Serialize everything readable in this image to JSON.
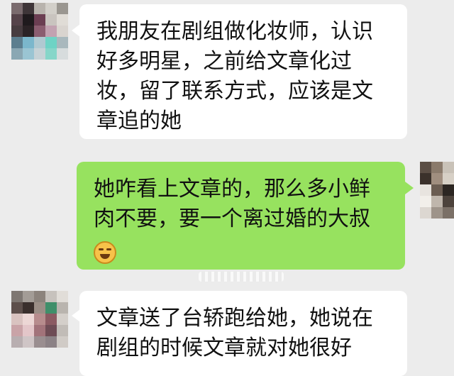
{
  "messages": [
    {
      "direction": "incoming",
      "lines": [
        "我朋友在剧组做化妆师，认识",
        "好多明星，之前给文章化过",
        "妆，留了联系方式，应该是文",
        "章追的她"
      ]
    },
    {
      "direction": "outgoing",
      "lines": [
        "她咋看上文章的，那么多小鲜",
        "肉不要，要一个离过婚的大叔"
      ],
      "emoji": "grinning-face-emoji"
    },
    {
      "direction": "incoming",
      "lines": [
        "文章送了台轿跑给她，她说在",
        "剧组的时候文章就对她很好"
      ]
    }
  ],
  "colors": {
    "background": "#ececec",
    "incoming_bubble": "#ffffff",
    "outgoing_bubble": "#97e25f"
  }
}
